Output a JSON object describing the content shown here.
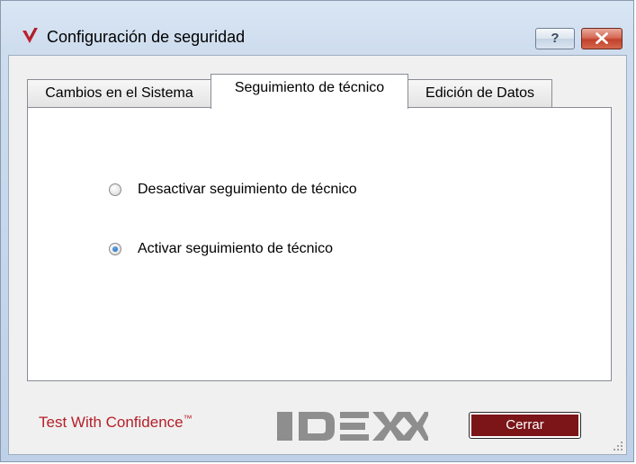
{
  "window": {
    "title": "Configuración de seguridad",
    "help_label": "?"
  },
  "tabs": [
    {
      "label": "Cambios en el Sistema",
      "active": false
    },
    {
      "label": "Seguimiento de técnico",
      "active": true
    },
    {
      "label": "Edición de Datos",
      "active": false
    }
  ],
  "options": [
    {
      "label": "Desactivar seguimiento de técnico",
      "checked": false
    },
    {
      "label": "Activar seguimiento de técnico",
      "checked": true
    }
  ],
  "footer": {
    "tagline": "Test With Confidence",
    "tagline_mark": "™",
    "logo_text": "IDEXX",
    "close_label": "Cerrar"
  },
  "colors": {
    "brand_red": "#b51f29",
    "button_maroon": "#7b1518",
    "logo_gray": "#8e8e8e"
  },
  "icons": {
    "app": "idexx-check-icon",
    "help": "help-icon",
    "close": "close-icon",
    "grip": "resize-grip-icon"
  }
}
